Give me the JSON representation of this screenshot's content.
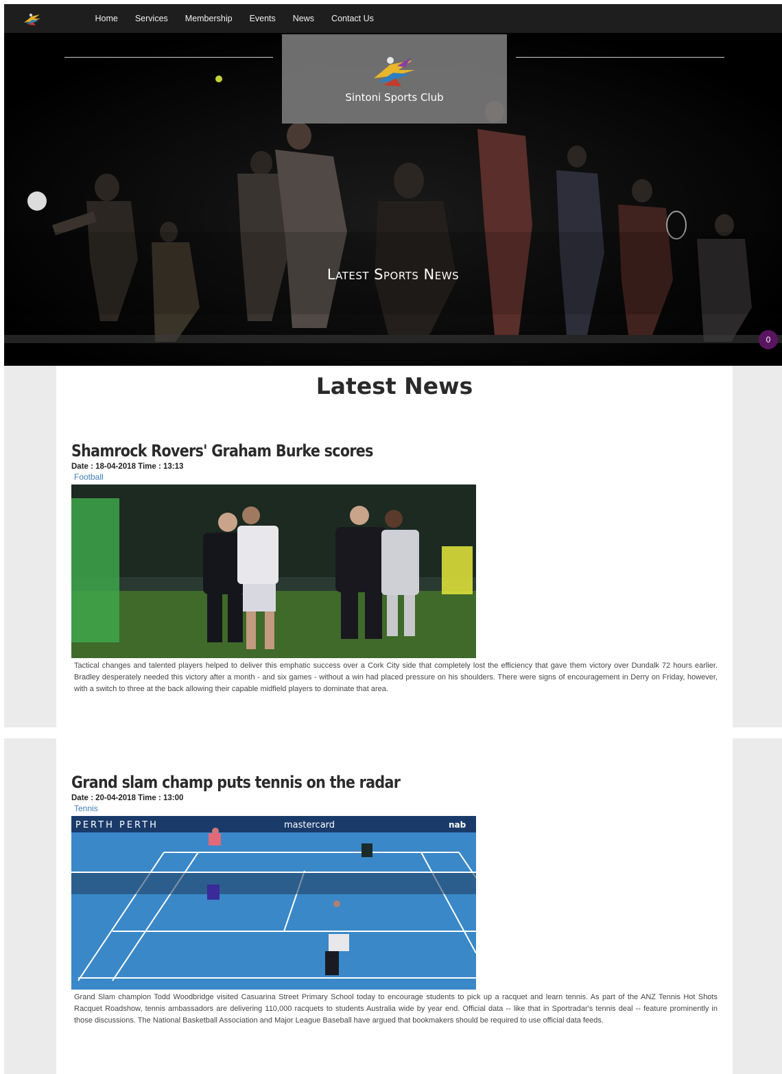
{
  "nav": {
    "logo_icon": "runner-logo-icon",
    "items": [
      {
        "label": "Home"
      },
      {
        "label": "Services"
      },
      {
        "label": "Membership"
      },
      {
        "label": "Events"
      },
      {
        "label": "News"
      },
      {
        "label": "Contact Us"
      }
    ]
  },
  "hero": {
    "brand_name": "Sintoni Sports Club",
    "banner_title": "Latest Sports News",
    "cart_count": "0",
    "colors": {
      "brand_box": "#808080",
      "badge": "#5a1560"
    }
  },
  "news": {
    "heading": "Latest News",
    "articles": [
      {
        "title": "Shamrock Rovers' Graham Burke scores",
        "meta": "Date : 18-04-2018 Time : 13:13",
        "category": "Football",
        "body": "Tactical changes and talented players helped to deliver this emphatic success over a Cork City side that completely lost the efficiency that gave them victory over Dundalk 72 hours earlier. Bradley desperately needed this victory after a month - and six games - without a win had placed pressure on his shoulders. There were signs of encouragement in Derry on Friday, however, with a switch to three at the back allowing their capable midfield players to dominate that area."
      },
      {
        "title": "Grand slam champ puts tennis on the radar",
        "meta": "Date : 20-04-2018 Time : 13:00",
        "category": "Tennis",
        "body": "Grand Slam champion Todd Woodbridge visited Casuarina Street Primary School today to encourage students to pick up a racquet and learn tennis. As part of the ANZ Tennis Hot Shots Racquet Roadshow, tennis ambassadors are delivering 110,000 racquets to students Australia wide by year end. Official data -- like that in Sportradar's tennis deal -- feature prominently in those discussions. The National Basketball Association and Major League Baseball have argued that bookmakers should be required to use official data feeds.",
        "banner_left": "PERTH PERTH",
        "banner_mid": "mastercard",
        "banner_right": "nab"
      }
    ]
  }
}
